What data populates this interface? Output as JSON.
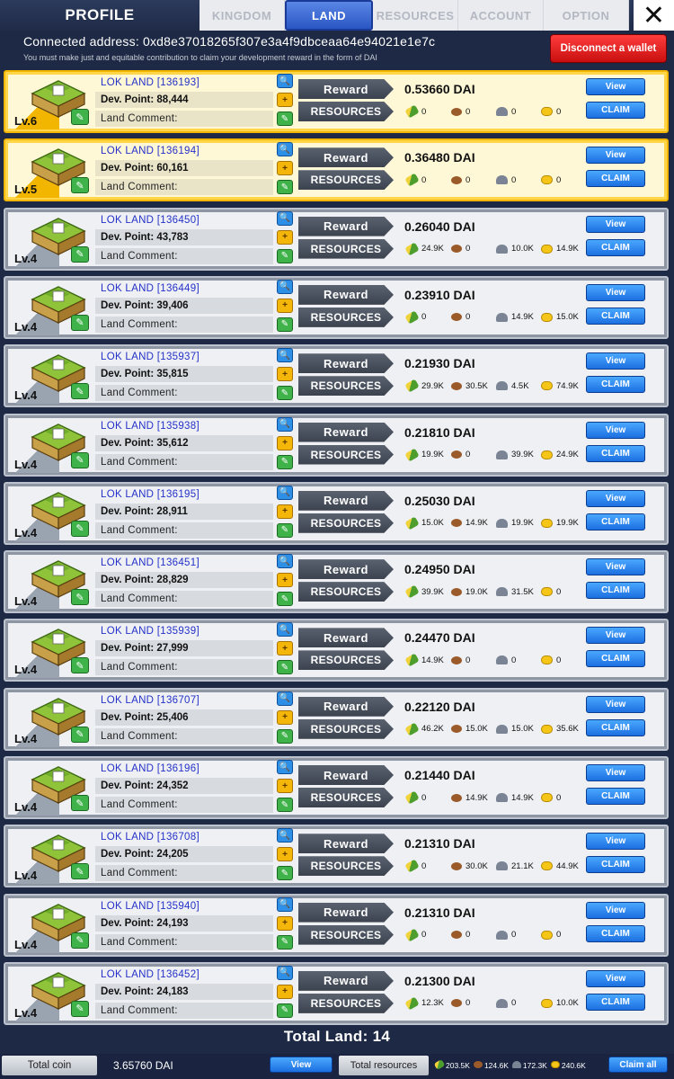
{
  "header": {
    "title": "PROFILE",
    "tabs": [
      "KINGDOM",
      "LAND",
      "RESOURCES",
      "ACCOUNT",
      "OPTION"
    ],
    "active_tab": "LAND",
    "close_icon": "close-icon"
  },
  "account": {
    "connected_address": "Connected address: 0xd8e37018265f307e3a4f9dbceaa64e94021e1e7c",
    "note": "You must make just and equitable contribution to claim your development reward in the form of DAI",
    "disconnect_label": "Disconnect a wallet"
  },
  "labels": {
    "reward": "Reward",
    "resources": "RESOURCES",
    "view": "View",
    "claim": "CLAIM",
    "land_comment": "Land Comment:"
  },
  "lands": [
    {
      "level": "Lv.6",
      "name": "LOK LAND [136193]",
      "dev_point": "Dev. Point: 88,444",
      "reward": "0.53660 DAI",
      "res": [
        "0",
        "0",
        "0",
        "0"
      ],
      "highlight": true
    },
    {
      "level": "Lv.5",
      "name": "LOK LAND [136194]",
      "dev_point": "Dev. Point: 60,161",
      "reward": "0.36480 DAI",
      "res": [
        "0",
        "0",
        "0",
        "0"
      ],
      "highlight": true
    },
    {
      "level": "Lv.4",
      "name": "LOK LAND [136450]",
      "dev_point": "Dev. Point: 43,783",
      "reward": "0.26040 DAI",
      "res": [
        "24.9K",
        "0",
        "10.0K",
        "14.9K"
      ],
      "highlight": false
    },
    {
      "level": "Lv.4",
      "name": "LOK LAND [136449]",
      "dev_point": "Dev. Point: 39,406",
      "reward": "0.23910 DAI",
      "res": [
        "0",
        "0",
        "14.9K",
        "15.0K"
      ],
      "highlight": false
    },
    {
      "level": "Lv.4",
      "name": "LOK LAND [135937]",
      "dev_point": "Dev. Point: 35,815",
      "reward": "0.21930 DAI",
      "res": [
        "29.9K",
        "30.5K",
        "4.5K",
        "74.9K"
      ],
      "highlight": false
    },
    {
      "level": "Lv.4",
      "name": "LOK LAND [135938]",
      "dev_point": "Dev. Point: 35,612",
      "reward": "0.21810 DAI",
      "res": [
        "19.9K",
        "0",
        "39.9K",
        "24.9K"
      ],
      "highlight": false
    },
    {
      "level": "Lv.4",
      "name": "LOK LAND [136195]",
      "dev_point": "Dev. Point: 28,911",
      "reward": "0.25030 DAI",
      "res": [
        "15.0K",
        "14.9K",
        "19.9K",
        "19.9K"
      ],
      "highlight": false
    },
    {
      "level": "Lv.4",
      "name": "LOK LAND [136451]",
      "dev_point": "Dev. Point: 28,829",
      "reward": "0.24950 DAI",
      "res": [
        "39.9K",
        "19.0K",
        "31.5K",
        "0"
      ],
      "highlight": false
    },
    {
      "level": "Lv.4",
      "name": "LOK LAND [135939]",
      "dev_point": "Dev. Point: 27,999",
      "reward": "0.24470 DAI",
      "res": [
        "14.9K",
        "0",
        "0",
        "0"
      ],
      "highlight": false
    },
    {
      "level": "Lv.4",
      "name": "LOK LAND [136707]",
      "dev_point": "Dev. Point: 25,406",
      "reward": "0.22120 DAI",
      "res": [
        "46.2K",
        "15.0K",
        "15.0K",
        "35.6K"
      ],
      "highlight": false
    },
    {
      "level": "Lv.4",
      "name": "LOK LAND [136196]",
      "dev_point": "Dev. Point: 24,352",
      "reward": "0.21440 DAI",
      "res": [
        "0",
        "14.9K",
        "14.9K",
        "0"
      ],
      "highlight": false
    },
    {
      "level": "Lv.4",
      "name": "LOK LAND [136708]",
      "dev_point": "Dev. Point: 24,205",
      "reward": "0.21310 DAI",
      "res": [
        "0",
        "30.0K",
        "21.1K",
        "44.9K"
      ],
      "highlight": false
    },
    {
      "level": "Lv.4",
      "name": "LOK LAND [135940]",
      "dev_point": "Dev. Point: 24,193",
      "reward": "0.21310 DAI",
      "res": [
        "0",
        "0",
        "0",
        "0"
      ],
      "highlight": false
    },
    {
      "level": "Lv.4",
      "name": "LOK LAND [136452]",
      "dev_point": "Dev. Point: 24,183",
      "reward": "0.21300 DAI",
      "res": [
        "12.3K",
        "0",
        "0",
        "10.0K"
      ],
      "highlight": false
    }
  ],
  "resource_icons": [
    "corn-icon",
    "wood-icon",
    "stone-icon",
    "gold-icon"
  ],
  "footer": {
    "total_land": "Total Land: 14",
    "total_coin_label": "Total coin",
    "total_coin_value": "3.65760 DAI",
    "view_label": "View",
    "total_resources_label": "Total resources",
    "total_resources": [
      "203.5K",
      "124.6K",
      "172.3K",
      "240.6K"
    ],
    "claim_all_label": "Claim all"
  },
  "colors": {
    "highlight_border": "#f2b600",
    "normal_border": "#bcc3ce",
    "accent_blue": "#1c6fe0",
    "disconnect_red": "#c80f0f"
  }
}
